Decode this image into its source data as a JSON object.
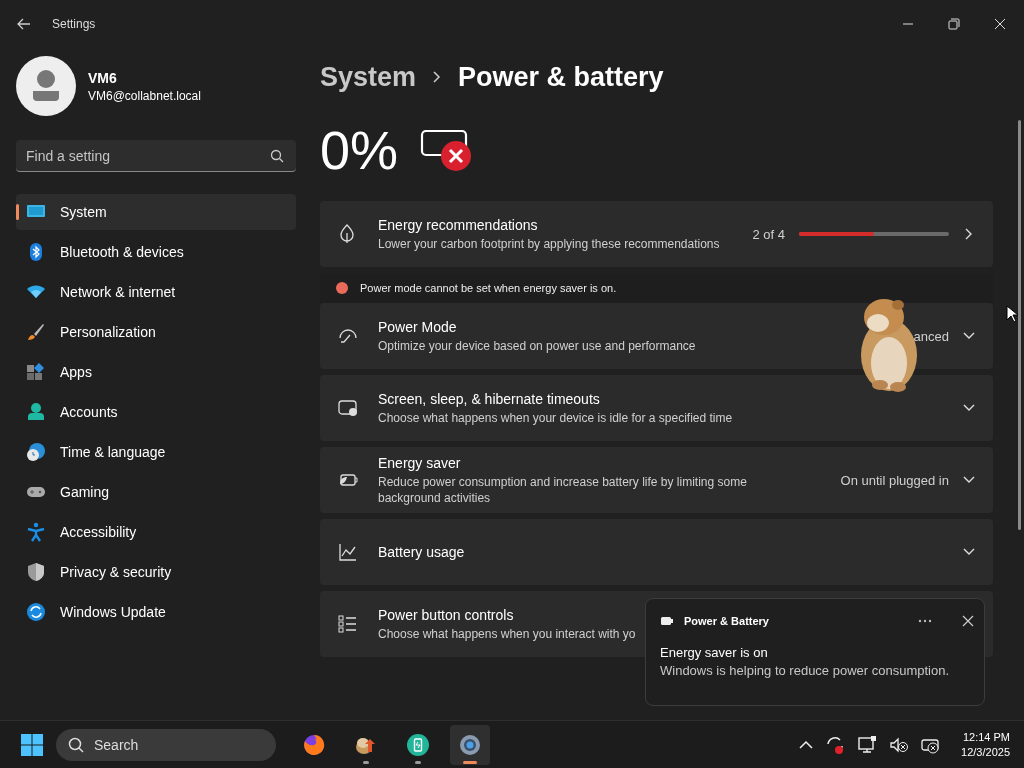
{
  "window": {
    "title": "Settings"
  },
  "account": {
    "name": "VM6",
    "email": "VM6@collabnet.local"
  },
  "search": {
    "placeholder": "Find a setting"
  },
  "nav": [
    {
      "label": "System",
      "selected": true
    },
    {
      "label": "Bluetooth & devices",
      "selected": false
    },
    {
      "label": "Network & internet",
      "selected": false
    },
    {
      "label": "Personalization",
      "selected": false
    },
    {
      "label": "Apps",
      "selected": false
    },
    {
      "label": "Accounts",
      "selected": false
    },
    {
      "label": "Time & language",
      "selected": false
    },
    {
      "label": "Gaming",
      "selected": false
    },
    {
      "label": "Accessibility",
      "selected": false
    },
    {
      "label": "Privacy & security",
      "selected": false
    },
    {
      "label": "Windows Update",
      "selected": false
    }
  ],
  "breadcrumb": {
    "parent": "System",
    "current": "Power & battery"
  },
  "battery": {
    "percent": "0%"
  },
  "cards": [
    {
      "kind": "progress",
      "title": "Energy recommendations",
      "description": "Lower your carbon footprint by applying these recommendations",
      "reading": "2 of 4",
      "level": 0.5,
      "chevron": true
    },
    {
      "kind": "note",
      "text": "Power mode cannot be set when energy saver is on."
    },
    {
      "kind": "dropdown",
      "title": "Power Mode",
      "description": "Optimize your device based on power use and performance",
      "value": "anced",
      "chevron": true
    },
    {
      "kind": "expander",
      "title": "Screen, sleep, & hibernate timeouts",
      "description": "Choose what happens when your device is idle for a specified time",
      "chevron": true
    },
    {
      "kind": "expander",
      "title": "Energy saver",
      "description": "Reduce power consumption and increase battery life by limiting some background activities",
      "value": "On until plugged in",
      "chevron": true
    },
    {
      "kind": "expander",
      "title": "Battery usage",
      "chevron": true
    },
    {
      "kind": "expander",
      "title": "Power button controls",
      "description": "Choose what happens when you interact with yo"
    }
  ],
  "toast": {
    "app": "Power & Battery",
    "title": "Energy saver is on",
    "body": "Windows is helping to reduce power consumption."
  },
  "taskbar": {
    "search": "Search",
    "apps": [
      {
        "running": false,
        "selected": false
      },
      {
        "running": true,
        "selected": false
      },
      {
        "running": true,
        "selected": false
      },
      {
        "running": true,
        "selected": true
      }
    ],
    "time": "12:14 PM",
    "date": "12/3/2025"
  }
}
